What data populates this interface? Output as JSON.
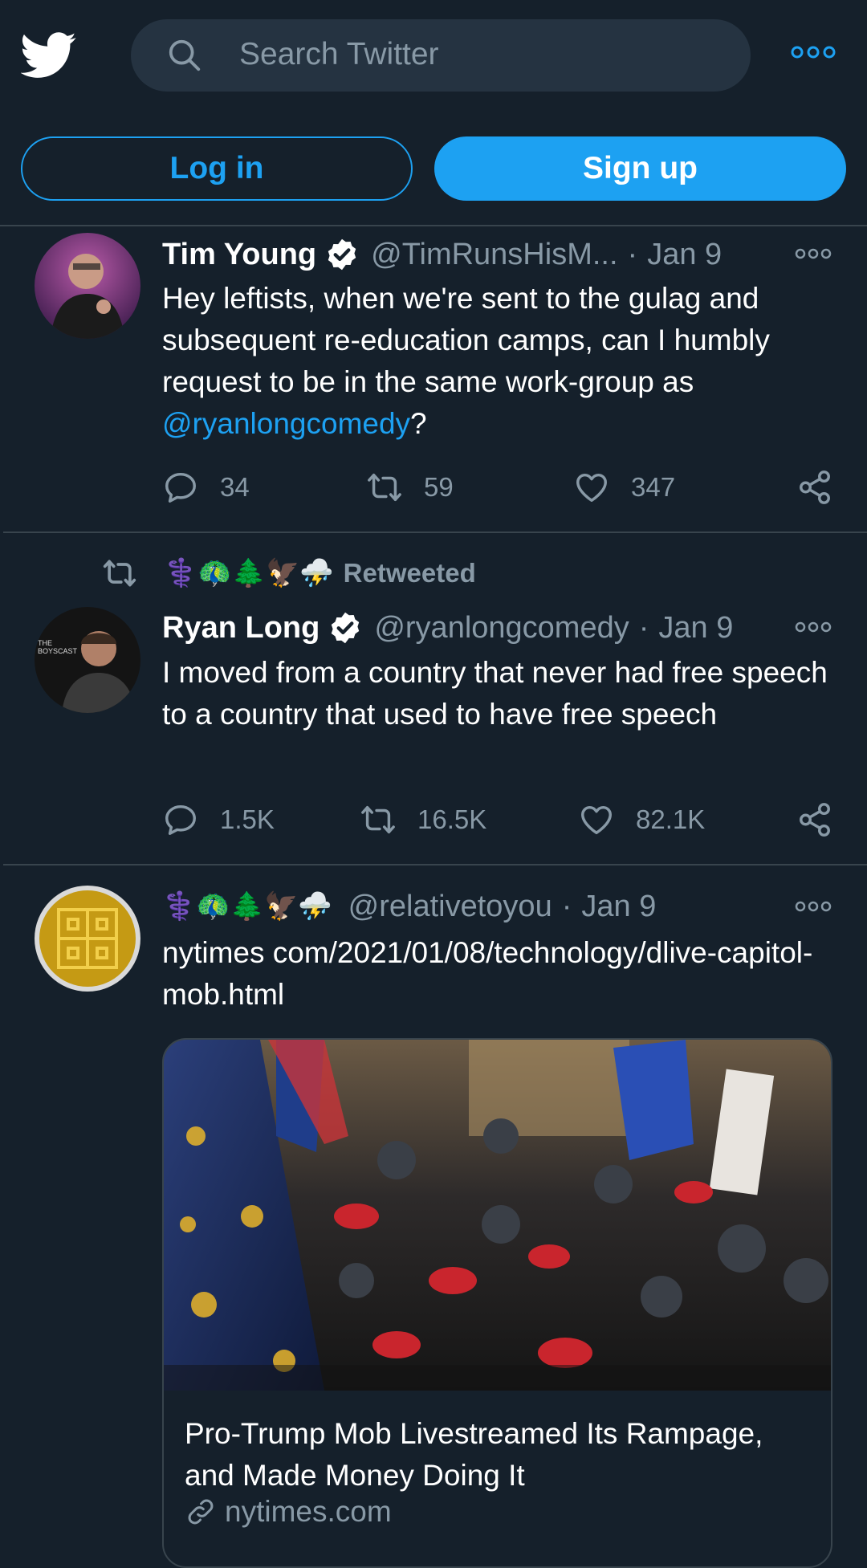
{
  "search": {
    "placeholder": "Search Twitter"
  },
  "auth": {
    "login_label": "Log in",
    "signup_label": "Sign up"
  },
  "tweets": [
    {
      "name": "Tim Young",
      "handle": "@TimRunsHisM...",
      "date": "Jan 9",
      "text_before": "Hey leftists, when we're sent to the gulag and subsequent re-education camps, can I humbly request to be in the same work-group as ",
      "mention": "@ryanlongcomedy",
      "text_after": "?",
      "replies": "34",
      "retweets": "59",
      "likes": "347",
      "verified": true
    },
    {
      "retweeted_by_emoji": "⚕️🦚🌲🦅⛈️",
      "retweeted_label": "Retweeted",
      "name": "Ryan Long",
      "handle": "@ryanlongcomedy",
      "date": "Jan 9",
      "text": "I moved from a country that never had free speech to a country that used to have free speech",
      "replies": "1.5K",
      "retweets": "16.5K",
      "likes": "82.1K",
      "verified": true
    },
    {
      "name_emoji": "⚕️🦚🌲🦅⛈️",
      "handle": "@relativetoyou",
      "date": "Jan 9",
      "text": "nytimes com/2021/01/08/technology/dlive-capitol-mob.html",
      "card": {
        "title": "Pro-Trump Mob Livestreamed Its Rampage, and Made Money Doing It",
        "domain": "nytimes.com"
      }
    }
  ],
  "colors": {
    "background": "#15202b",
    "accent": "#1da1f2",
    "secondary_text": "#8899a6",
    "divider": "#38444d"
  },
  "icons": [
    "twitter-logo-icon",
    "search-icon",
    "more-icon",
    "verified-icon",
    "reply-icon",
    "retweet-icon",
    "like-icon",
    "share-icon",
    "link-icon"
  ]
}
